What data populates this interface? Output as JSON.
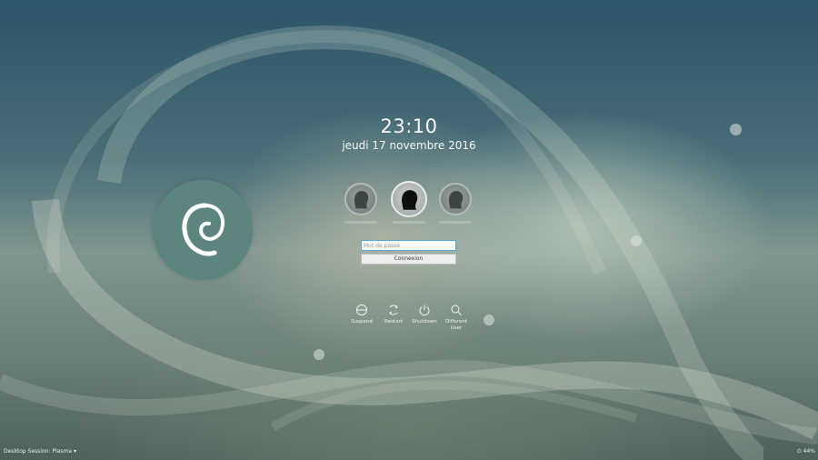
{
  "clock": {
    "time": "23:10",
    "date": "jeudi 17 novembre 2016"
  },
  "logo": {
    "icon": "debian-swirl-icon"
  },
  "users": [
    {
      "icon": "user-silhouette-icon",
      "selected": false
    },
    {
      "icon": "user-silhouette-icon",
      "selected": true
    },
    {
      "icon": "user-silhouette-icon",
      "selected": false
    }
  ],
  "login": {
    "password_placeholder": "Mot de passe",
    "button_label": "Connexion"
  },
  "actions": [
    {
      "label": "Suspend",
      "icon": "suspend-icon"
    },
    {
      "label": "Restart",
      "icon": "restart-icon"
    },
    {
      "label": "Shutdown",
      "icon": "power-icon"
    },
    {
      "label": "Different User",
      "icon": "search-icon"
    }
  ],
  "footer": {
    "session_label": "Desktop Session: Plasma ▾",
    "battery": "44%"
  },
  "colors": {
    "accent": "#5aa7d8",
    "logo_disc": "#5c8580"
  }
}
